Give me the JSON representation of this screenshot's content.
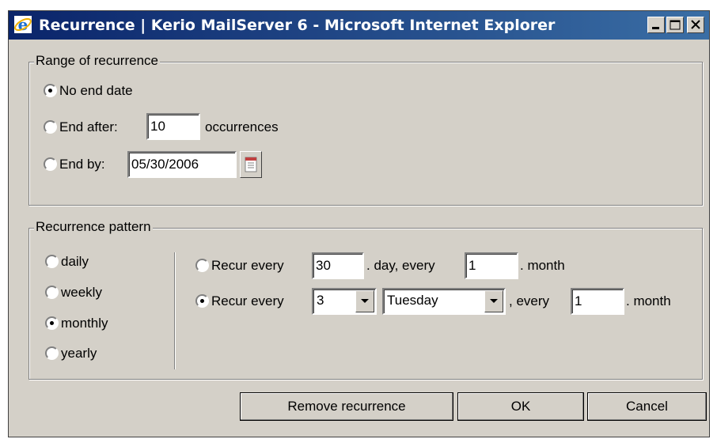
{
  "window": {
    "title": "Recurrence | Kerio MailServer 6 - Microsoft Internet Explorer",
    "icon": "ie-icon",
    "controls": [
      "minimize-icon",
      "maximize-icon",
      "close-icon"
    ]
  },
  "range": {
    "legend": "Range of recurrence",
    "options": {
      "no_end": {
        "label": "No end date",
        "selected": true
      },
      "end_after": {
        "label": "End after:",
        "value": "10",
        "suffix": "occurrences",
        "selected": false
      },
      "end_by": {
        "label": "End by:",
        "value": "05/30/2006",
        "selected": false,
        "calendar_icon": "calendar-icon"
      }
    }
  },
  "pattern": {
    "legend": "Recurrence pattern",
    "frequencies": [
      {
        "label": "daily",
        "selected": false
      },
      {
        "label": "weekly",
        "selected": false
      },
      {
        "label": "monthly",
        "selected": true
      },
      {
        "label": "yearly",
        "selected": false
      }
    ],
    "monthly": {
      "option1": {
        "label": "Recur every",
        "day_value": "30",
        "mid_text": ". day, every",
        "month_value": "1",
        "end_text": ". month",
        "selected": false
      },
      "option2": {
        "label": "Recur every",
        "ordinal": "3",
        "weekday": "Tuesday",
        "mid_text": ", every",
        "month_value": "1",
        "end_text": ". month",
        "selected": true
      }
    }
  },
  "buttons": {
    "remove": "Remove recurrence",
    "ok": "OK",
    "cancel": "Cancel"
  }
}
